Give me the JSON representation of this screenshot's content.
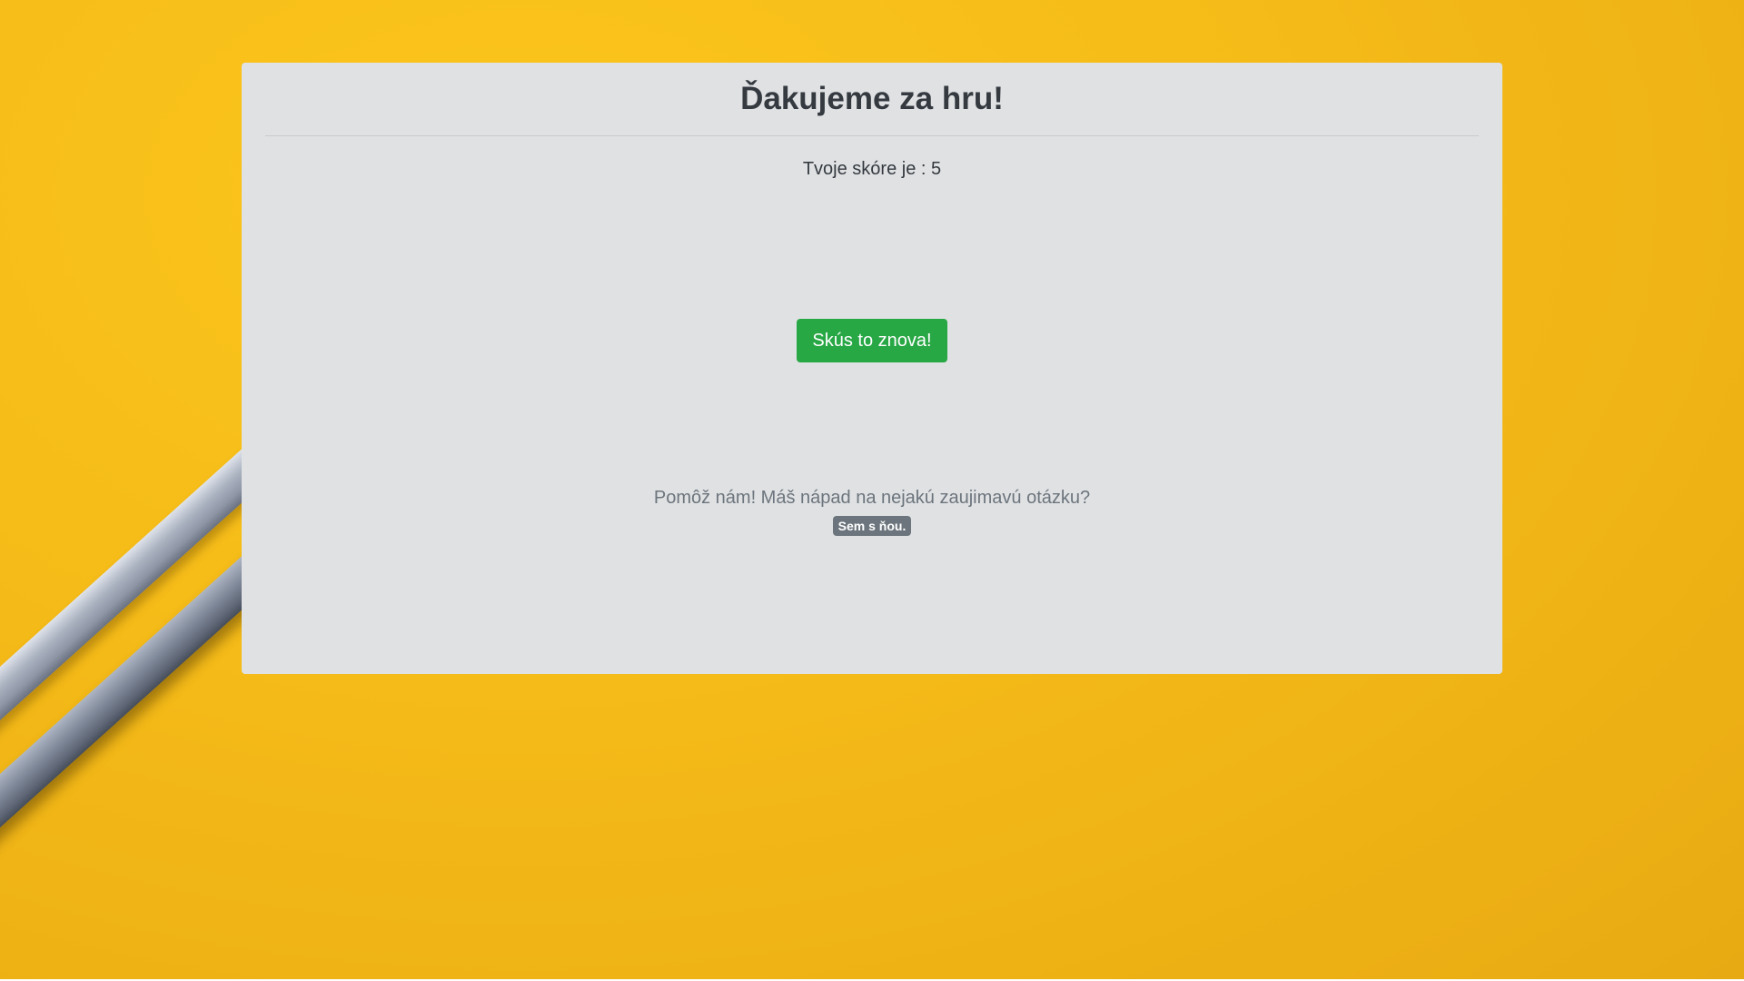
{
  "card": {
    "title": "Ďakujeme za hru!",
    "score_text": "Tvoje skóre je : 5",
    "retry_button_label": "Skús to znova!",
    "help_text": "Pomôž nám! Máš nápad na nejakú zaujimavú otázku?",
    "help_link_label": "Sem s ňou."
  },
  "colors": {
    "background": "#f5bb18",
    "card": "#e0e1e3",
    "retry_button": "#28a745",
    "help_badge": "#6c757d"
  },
  "icons": [
    "pencil-decoration"
  ]
}
